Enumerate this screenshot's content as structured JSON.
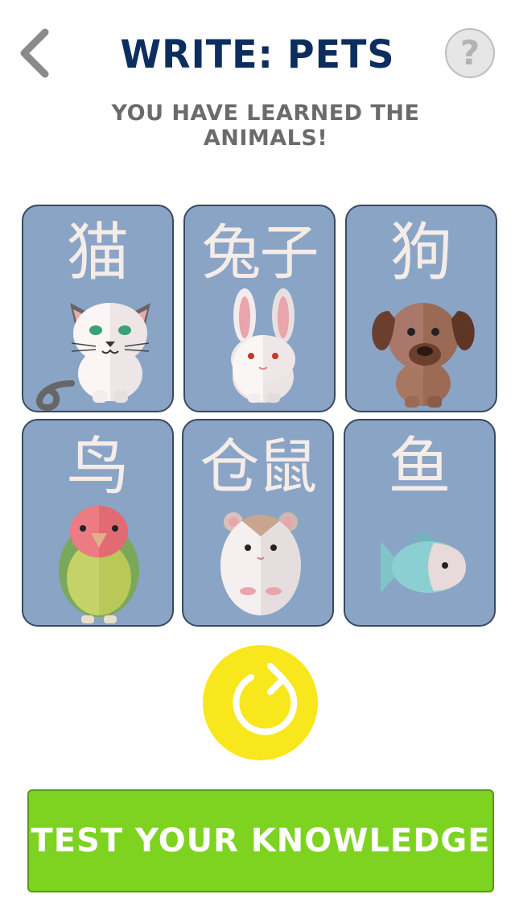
{
  "header": {
    "title": "WRITE: PETS",
    "subtitle": "YOU HAVE LEARNED THE ANIMALS!",
    "back_icon": "chevron-left-icon",
    "help_label": "?"
  },
  "cards": [
    {
      "word": "猫",
      "animal": "cat"
    },
    {
      "word": "兔子",
      "animal": "rabbit"
    },
    {
      "word": "狗",
      "animal": "dog"
    },
    {
      "word": "鸟",
      "animal": "bird"
    },
    {
      "word": "仓鼠",
      "animal": "hamster"
    },
    {
      "word": "鱼",
      "animal": "fish"
    }
  ],
  "actions": {
    "reload_icon": "reload-icon",
    "test_label": "TEST YOUR KNOWLEDGE"
  },
  "colors": {
    "title": "#0c2e5e",
    "card_bg": "#8aa4c6",
    "reload_bg": "#f8e71c",
    "test_bg": "#7ed321"
  }
}
